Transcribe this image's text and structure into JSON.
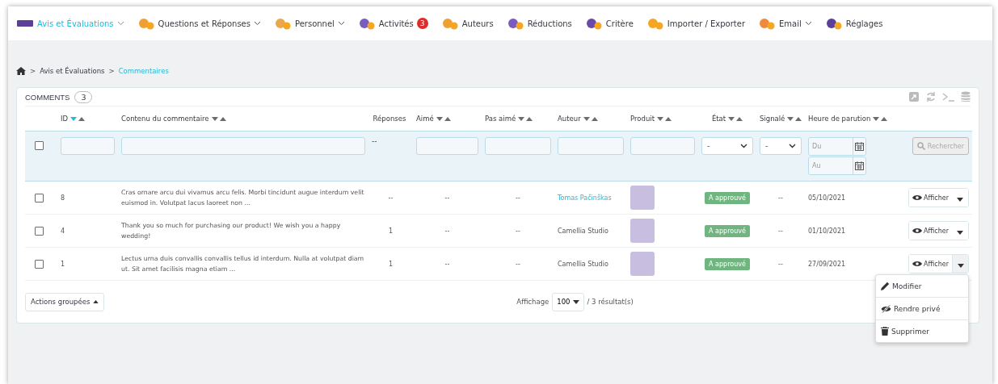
{
  "nav": [
    {
      "label": "Avis et Évaluations",
      "selected": true,
      "has_menu": true
    },
    {
      "label": "Questions et Réponses",
      "selected": false,
      "has_menu": true
    },
    {
      "label": "Personnel",
      "selected": false,
      "has_menu": true
    },
    {
      "label": "Activités",
      "selected": false,
      "has_menu": false,
      "badge": "3"
    },
    {
      "label": "Auteurs",
      "selected": false,
      "has_menu": false
    },
    {
      "label": "Réductions",
      "selected": false,
      "has_menu": false
    },
    {
      "label": "Critère",
      "selected": false,
      "has_menu": false
    },
    {
      "label": "Importer / Exporter",
      "selected": false,
      "has_menu": false
    },
    {
      "label": "Email",
      "selected": false,
      "has_menu": true
    },
    {
      "label": "Réglages",
      "selected": false,
      "has_menu": false
    }
  ],
  "breadcrumb": [
    {
      "separator": ">",
      "label": "Avis et Évaluations"
    },
    {
      "separator": ">",
      "label": "Commentaires"
    }
  ],
  "panel": {
    "title": "COMMENTS",
    "count": "3"
  },
  "columns": [
    {
      "filter": {
        "kind": "checkbox",
        "checked": false
      }
    },
    {
      "label": "ID",
      "sortable": true,
      "sort_desc_active": true,
      "filter": {
        "kind": "text"
      }
    },
    {
      "label": "Contenu du commentaire",
      "sortable": true,
      "sort_desc_active": false,
      "filter": {
        "kind": "text"
      }
    },
    {
      "label": "Réponses",
      "sortable": false,
      "filter": {
        "kind": "dash",
        "text": "--"
      }
    },
    {
      "label": "Aimé",
      "sortable": true,
      "sort_desc_active": false,
      "filter": {
        "kind": "text"
      }
    },
    {
      "label": "Pas aimé",
      "sortable": true,
      "sort_desc_active": false,
      "filter": {
        "kind": "text"
      }
    },
    {
      "label": "Auteur",
      "sortable": true,
      "sort_desc_active": false,
      "filter": {
        "kind": "text"
      }
    },
    {
      "label": "Produit",
      "sortable": true,
      "sort_desc_active": false,
      "filter": {
        "kind": "text"
      }
    },
    {
      "label": "État",
      "sortable": true,
      "sort_desc_active": false,
      "filter": {
        "kind": "select",
        "value": "-"
      }
    },
    {
      "label": "Signalé",
      "sortable": true,
      "sort_desc_active": false,
      "filter": {
        "kind": "select",
        "value": "-"
      }
    },
    {
      "label": "Heure de parution",
      "sortable": true,
      "sort_desc_active": false,
      "filter": {
        "kind": "daterange",
        "from_placeholder": "Du",
        "to_placeholder": "Au"
      }
    },
    {
      "filter": {
        "kind": "button",
        "text": "Rechercher"
      }
    }
  ],
  "rows": [
    {
      "checked": false,
      "id": "8",
      "content": "Cras ornare arcu dui vivamus arcu felis. Morbi tincidunt augue interdum velit euismod in. Volutpat lacus laoreet non ...",
      "replies": "--",
      "likes": "--",
      "dislikes": "--",
      "author": "Tomas Pačinškas",
      "author_link": true,
      "state": "A approuvé",
      "reported": "--",
      "date": "05/10/2021",
      "action": "Afficher",
      "menu_open": false
    },
    {
      "checked": false,
      "id": "4",
      "content": "Thank you so much for purchasing our product! We wish you a happy wedding!",
      "replies": "1",
      "likes": "--",
      "dislikes": "--",
      "author": "Camellia Studio",
      "author_link": false,
      "state": "A approuvé",
      "reported": "--",
      "date": "01/10/2021",
      "action": "Afficher",
      "menu_open": false
    },
    {
      "checked": false,
      "id": "1",
      "content": "Lectus urna duis convallis convallis tellus id interdum. Nulla at volutpat diam ut. Sit amet facilisis magna etiam ...",
      "replies": "1",
      "likes": "--",
      "dislikes": "--",
      "author": "Camellia Studio",
      "author_link": false,
      "state": "A approuvé",
      "reported": "--",
      "date": "27/09/2021",
      "action": "Afficher",
      "menu_open": true
    }
  ],
  "row_menu": [
    {
      "kind": "edit",
      "label": "Modifier"
    },
    {
      "kind": "private",
      "label": "Rendre privé"
    },
    {
      "kind": "delete",
      "label": "Supprimer"
    }
  ],
  "footer": {
    "bulk_actions": "Actions groupées",
    "display_label": "Affichage",
    "per_page": "100",
    "results": "/ 3 résultat(s)"
  }
}
